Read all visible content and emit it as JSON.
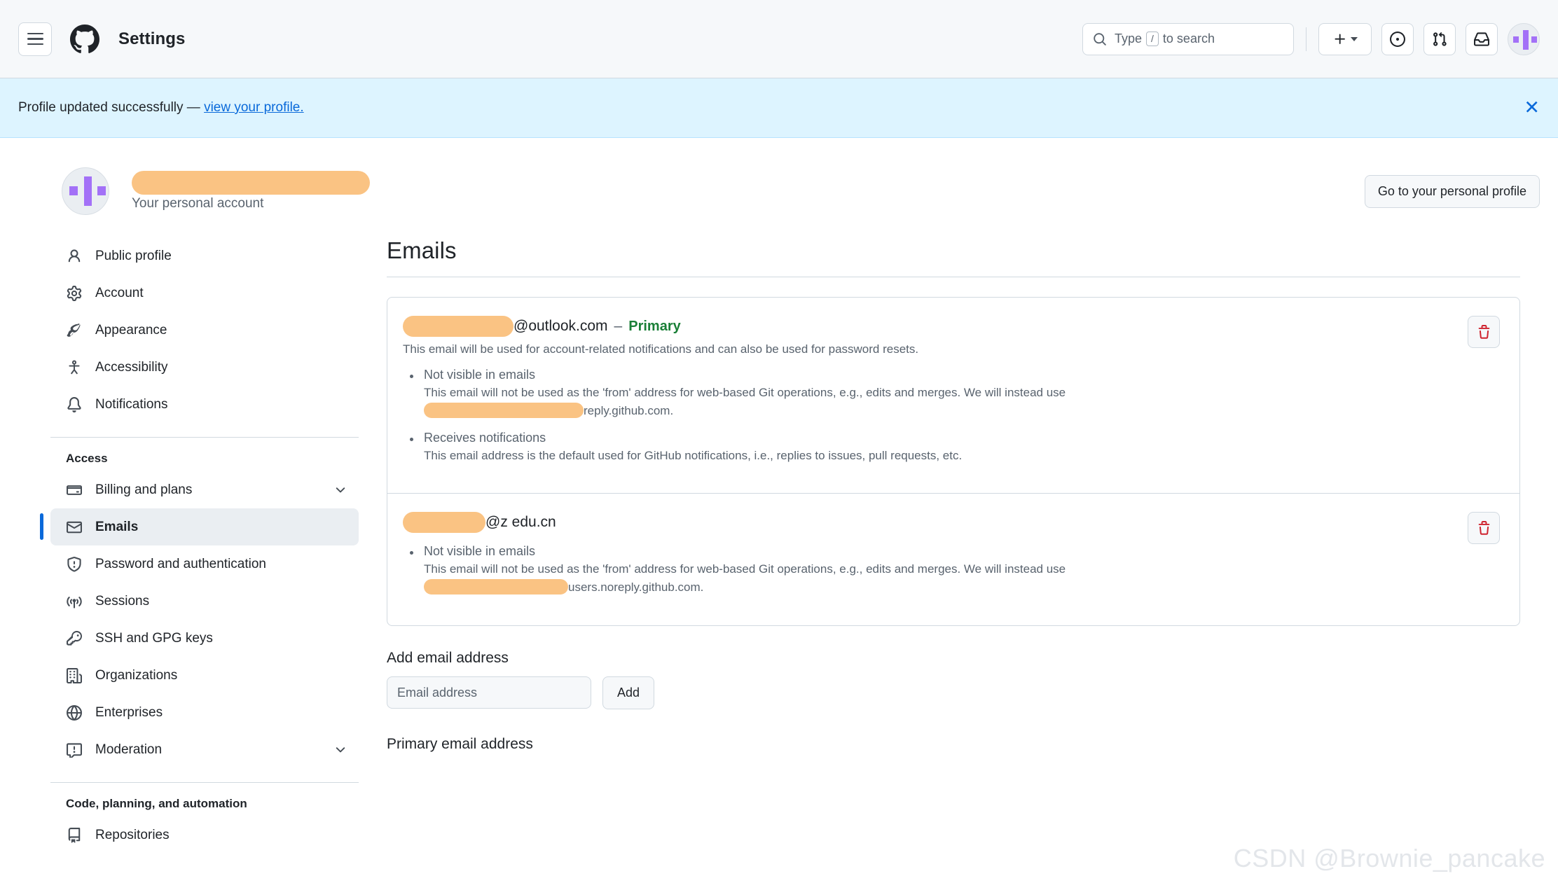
{
  "header": {
    "menu_icon": "hamburger-icon",
    "logo_icon": "github-logo-icon",
    "title": "Settings",
    "search": {
      "prefix": "Type",
      "key": "/",
      "suffix": "to search"
    },
    "actions": [
      {
        "name": "create-new-button",
        "icon": "plus-icon"
      },
      {
        "name": "issues-button",
        "icon": "circle-dot-icon"
      },
      {
        "name": "pull-requests-button",
        "icon": "git-pull-request-icon"
      },
      {
        "name": "notifications-inbox-button",
        "icon": "inbox-icon"
      }
    ],
    "avatar_icon": "user-avatar-identicon"
  },
  "banner": {
    "message": "Profile updated successfully —",
    "link": "view your profile.",
    "close_icon": "close-icon",
    "background": "#ddf4ff"
  },
  "profile": {
    "username_redacted": "",
    "subtitle": "Your personal account",
    "go_to_profile_label": "Go to your personal profile"
  },
  "sidebar": {
    "items": [
      {
        "label": "Public profile",
        "icon": "person-icon",
        "selected": false,
        "chevron": false
      },
      {
        "label": "Account",
        "icon": "gear-icon",
        "selected": false,
        "chevron": false
      },
      {
        "label": "Appearance",
        "icon": "paintbrush-icon",
        "selected": false,
        "chevron": false
      },
      {
        "label": "Accessibility",
        "icon": "accessibility-icon",
        "selected": false,
        "chevron": false
      },
      {
        "label": "Notifications",
        "icon": "bell-icon",
        "selected": false,
        "chevron": false
      }
    ],
    "access_group": {
      "title": "Access",
      "items": [
        {
          "label": "Billing and plans",
          "icon": "credit-card-icon",
          "selected": false,
          "chevron": true
        },
        {
          "label": "Emails",
          "icon": "mail-icon",
          "selected": true,
          "chevron": false
        },
        {
          "label": "Password and authentication",
          "icon": "shield-lock-icon",
          "selected": false,
          "chevron": false
        },
        {
          "label": "Sessions",
          "icon": "broadcast-icon",
          "selected": false,
          "chevron": false
        },
        {
          "label": "SSH and GPG keys",
          "icon": "key-icon",
          "selected": false,
          "chevron": false
        },
        {
          "label": "Organizations",
          "icon": "organization-icon",
          "selected": false,
          "chevron": false
        },
        {
          "label": "Enterprises",
          "icon": "globe-icon",
          "selected": false,
          "chevron": false
        },
        {
          "label": "Moderation",
          "icon": "report-icon",
          "selected": false,
          "chevron": true
        }
      ]
    },
    "code_group": {
      "title": "Code, planning, and automation",
      "items": [
        {
          "label": "Repositories",
          "icon": "repo-icon",
          "selected": false,
          "chevron": false
        }
      ]
    }
  },
  "main": {
    "page_title": "Emails",
    "emails": [
      {
        "address_suffix": "@outlook.com",
        "separator": "–",
        "badge": "Primary",
        "badge_color": "#1a7f37",
        "description": "This email will be used for account-related notifications and can also be used for password resets.",
        "bullets": [
          {
            "title": "Not visible in emails",
            "body_before": "This email will not be used as the 'from' address for web-based Git operations, e.g., edits and merges. We will instead use",
            "body_after": "reply.github.com."
          },
          {
            "title": "Receives notifications",
            "body_before": "This email address is the default used for GitHub notifications, i.e., replies to issues, pull requests, etc.",
            "body_after": ""
          }
        ],
        "delete_icon": "trash-icon"
      },
      {
        "address_suffix": "@z  edu.cn",
        "separator": "",
        "badge": "",
        "badge_color": "",
        "description": "",
        "bullets": [
          {
            "title": "Not visible in emails",
            "body_before": "This email will not be used as the 'from' address for web-based Git operations, e.g., edits and merges. We will instead use",
            "body_after": "users.noreply.github.com."
          }
        ],
        "delete_icon": "trash-icon"
      }
    ],
    "add_email": {
      "label": "Add email address",
      "placeholder": "Email address",
      "value": "",
      "button": "Add"
    },
    "primary_email_section_title": "Primary email address"
  },
  "watermark": "CSDN @Brownie_pancake"
}
